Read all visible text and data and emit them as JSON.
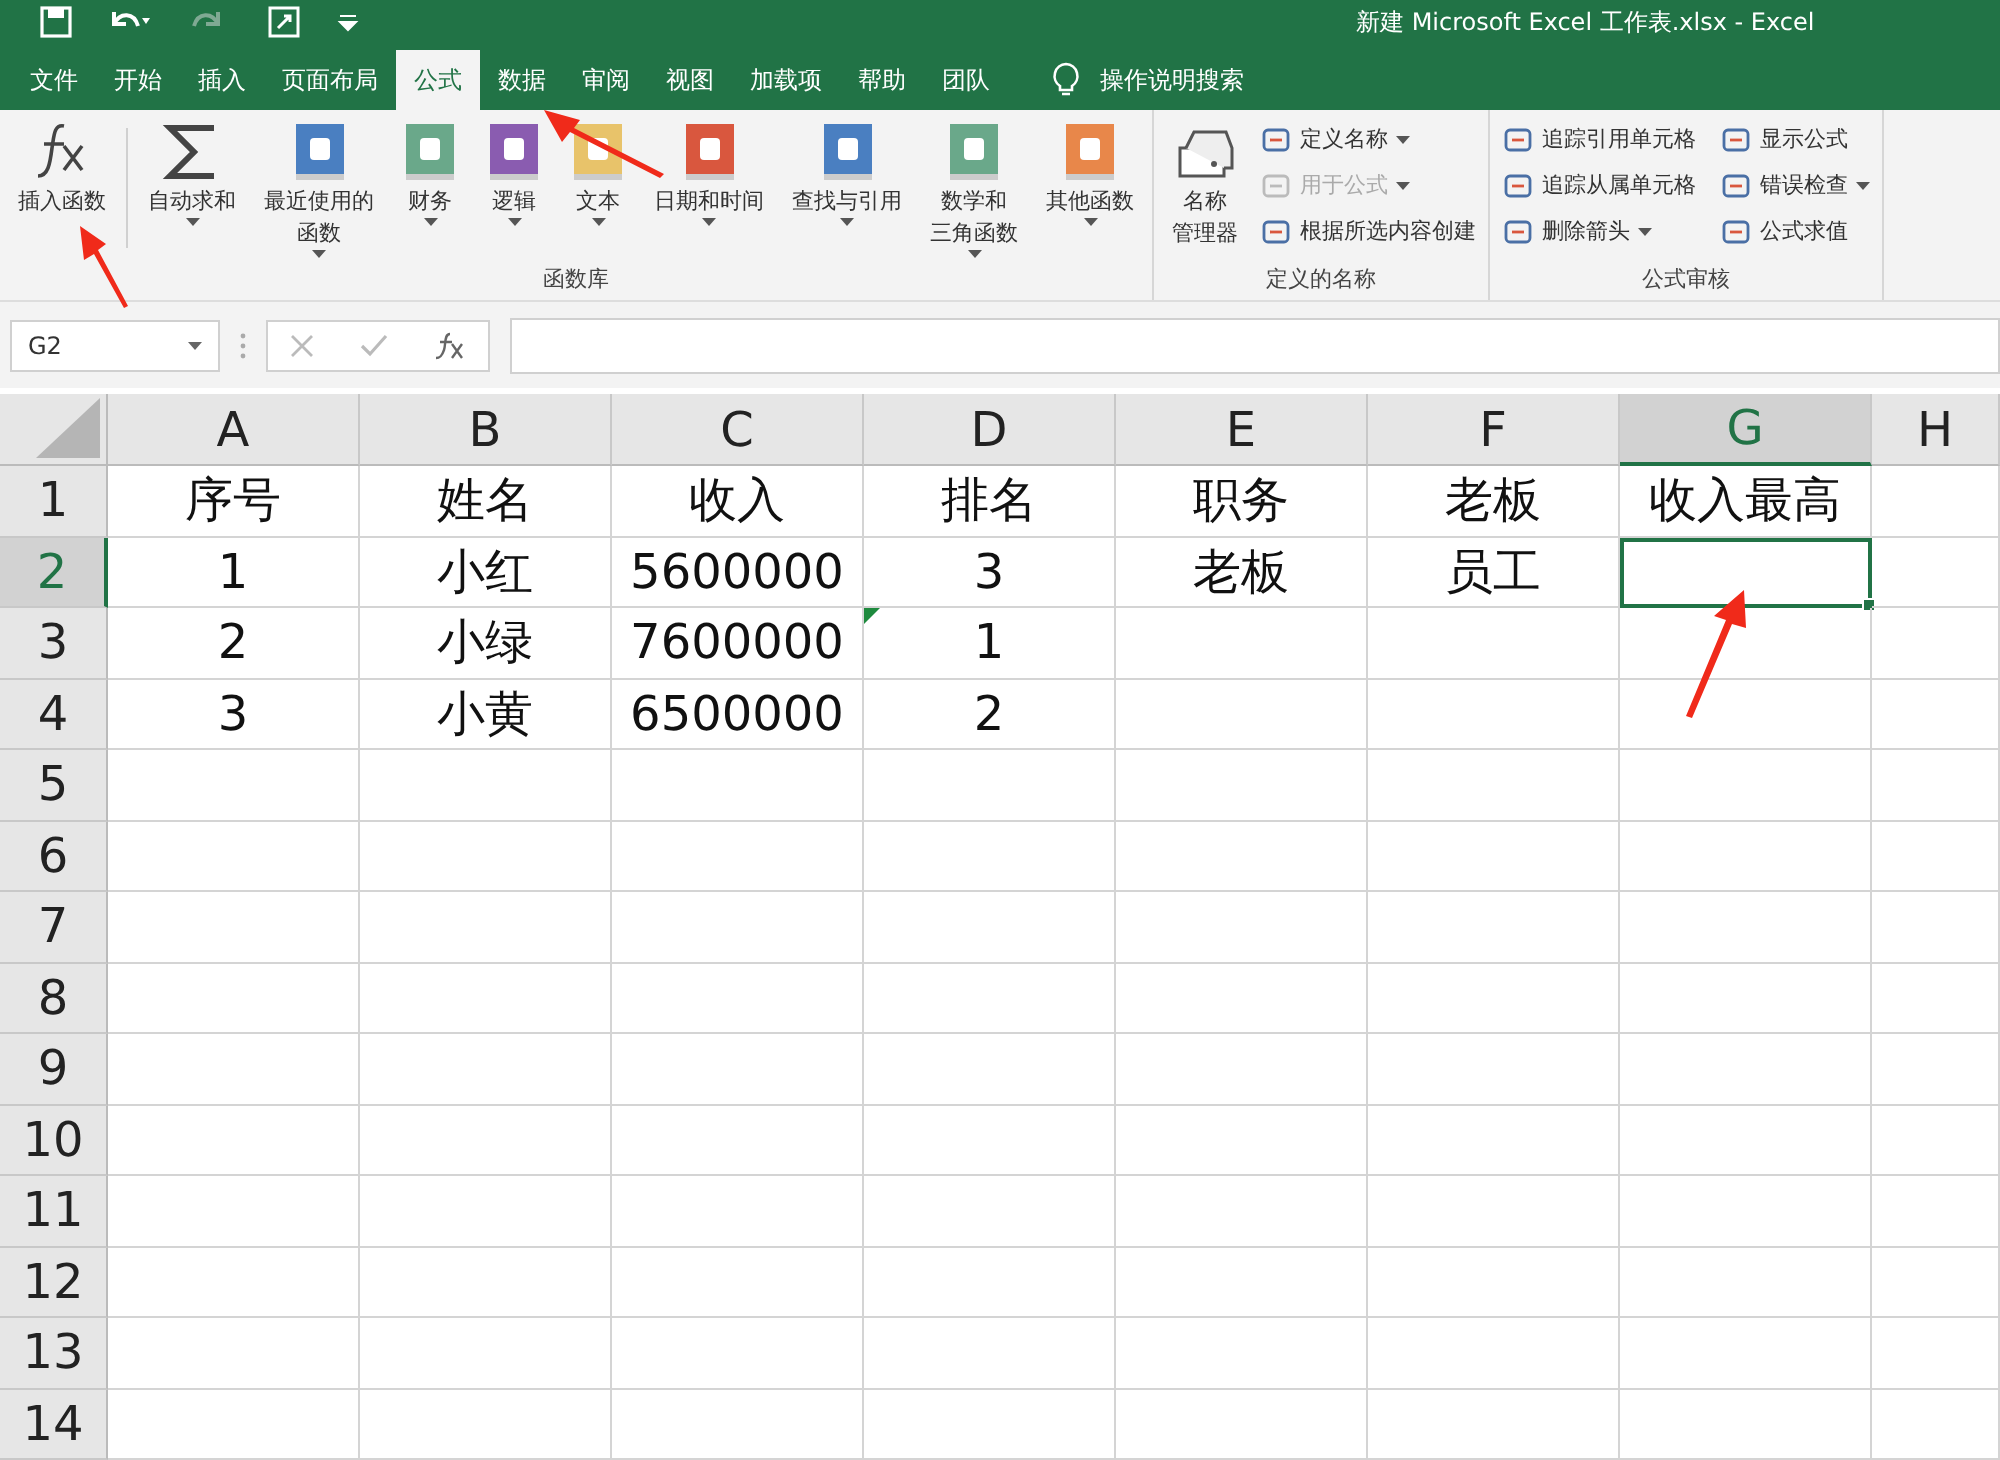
{
  "window": {
    "title": "新建 Microsoft Excel 工作表.xlsx  -  Excel"
  },
  "tabs": [
    {
      "label": "文件",
      "selected": false
    },
    {
      "label": "开始",
      "selected": false
    },
    {
      "label": "插入",
      "selected": false
    },
    {
      "label": "页面布局",
      "selected": false
    },
    {
      "label": "公式",
      "selected": true
    },
    {
      "label": "数据",
      "selected": false
    },
    {
      "label": "审阅",
      "selected": false
    },
    {
      "label": "视图",
      "selected": false
    },
    {
      "label": "加载项",
      "selected": false
    },
    {
      "label": "帮助",
      "selected": false
    },
    {
      "label": "团队",
      "selected": false
    }
  ],
  "tell_me": {
    "label": "操作说明搜索"
  },
  "ribbon": {
    "groups": [
      {
        "label": "函数库",
        "large": [
          {
            "lines": [
              "插入函数"
            ],
            "dropdown": false
          },
          {
            "lines": [
              "自动求和"
            ],
            "dropdown": true
          },
          {
            "lines": [
              "最近使用的",
              "函数"
            ],
            "dropdown": true
          },
          {
            "lines": [
              "财务"
            ],
            "dropdown": true
          },
          {
            "lines": [
              "逻辑"
            ],
            "dropdown": true
          },
          {
            "lines": [
              "文本"
            ],
            "dropdown": true
          },
          {
            "lines": [
              "日期和时间"
            ],
            "dropdown": true
          },
          {
            "lines": [
              "查找与引用"
            ],
            "dropdown": true
          },
          {
            "lines": [
              "数学和",
              "三角函数"
            ],
            "dropdown": true
          },
          {
            "lines": [
              "其他函数"
            ],
            "dropdown": true
          }
        ]
      },
      {
        "label": "定义的名称",
        "large": [
          {
            "lines": [
              "名称",
              "管理器"
            ],
            "dropdown": false
          }
        ],
        "small": [
          {
            "label": "定义名称",
            "dropdown": true,
            "disabled": false
          },
          {
            "label": "用于公式",
            "dropdown": true,
            "disabled": true
          },
          {
            "label": "根据所选内容创建",
            "dropdown": false,
            "disabled": false
          }
        ]
      },
      {
        "label": "公式审核",
        "small": [
          {
            "label": "追踪引用单元格",
            "dropdown": false,
            "disabled": false
          },
          {
            "label": "追踪从属单元格",
            "dropdown": false,
            "disabled": false
          },
          {
            "label": "删除箭头",
            "dropdown": true,
            "disabled": false
          },
          {
            "label": "显示公式",
            "dropdown": false,
            "disabled": false
          },
          {
            "label": "错误检查",
            "dropdown": true,
            "disabled": false
          },
          {
            "label": "公式求值",
            "dropdown": false,
            "disabled": false
          }
        ]
      }
    ]
  },
  "formula_bar": {
    "name_box": "G2"
  },
  "sheet": {
    "columns": [
      {
        "label": "A",
        "selected": false
      },
      {
        "label": "B",
        "selected": false
      },
      {
        "label": "C",
        "selected": false
      },
      {
        "label": "D",
        "selected": false
      },
      {
        "label": "E",
        "selected": false
      },
      {
        "label": "F",
        "selected": false
      },
      {
        "label": "G",
        "selected": true
      },
      {
        "label": "H",
        "selected": false
      }
    ],
    "rows": [
      {
        "label": "1",
        "selected": false,
        "cells": [
          {
            "text": "序号"
          },
          {
            "text": "姓名"
          },
          {
            "text": "收入"
          },
          {
            "text": "排名"
          },
          {
            "text": "职务"
          },
          {
            "text": "老板"
          },
          {
            "text": "收入最高"
          },
          {}
        ]
      },
      {
        "label": "2",
        "selected": true,
        "cells": [
          {
            "text": "1"
          },
          {
            "text": "小红"
          },
          {
            "text": "5600000"
          },
          {
            "text": "3"
          },
          {
            "text": "老板"
          },
          {
            "text": "员工"
          },
          {
            "active": true
          },
          {}
        ]
      },
      {
        "label": "3",
        "selected": false,
        "cells": [
          {
            "text": "2"
          },
          {
            "text": "小绿"
          },
          {
            "text": "7600000"
          },
          {
            "text": "1",
            "warning": true
          },
          {},
          {},
          {},
          {}
        ]
      },
      {
        "label": "4",
        "selected": false,
        "cells": [
          {
            "text": "3"
          },
          {
            "text": "小黄"
          },
          {
            "text": "6500000"
          },
          {
            "text": "2"
          },
          {},
          {},
          {},
          {}
        ]
      },
      {
        "label": "5",
        "selected": false,
        "cells": []
      },
      {
        "label": "6",
        "selected": false,
        "cells": []
      },
      {
        "label": "7",
        "selected": false,
        "cells": []
      },
      {
        "label": "8",
        "selected": false,
        "cells": []
      },
      {
        "label": "9",
        "selected": false,
        "cells": []
      },
      {
        "label": "10",
        "selected": false,
        "cells": []
      },
      {
        "label": "11",
        "selected": false,
        "cells": []
      },
      {
        "label": "12",
        "selected": false,
        "cells": []
      },
      {
        "label": "13",
        "selected": false,
        "cells": []
      },
      {
        "label": "14",
        "selected": false,
        "cells": []
      }
    ]
  }
}
